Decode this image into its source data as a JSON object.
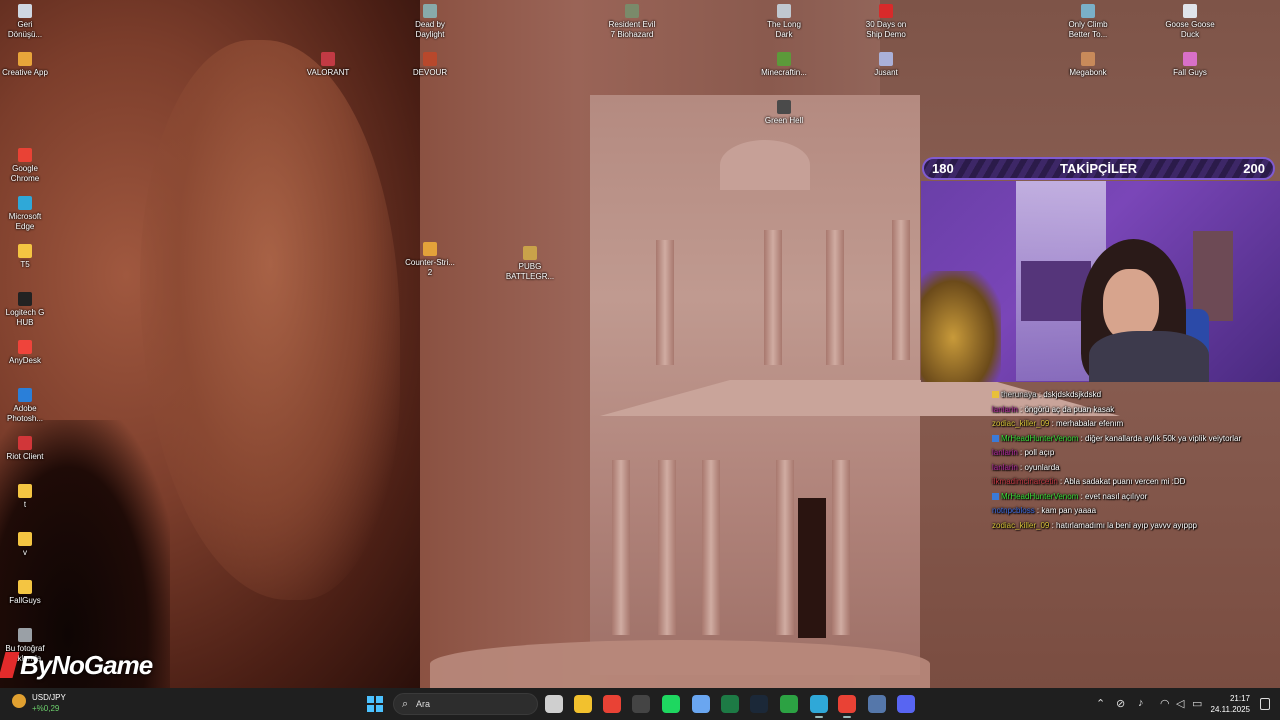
{
  "desktop_icons": [
    {
      "label": "Geri\nDönüşü...",
      "icon": "recycle-bin-icon",
      "color": "#cfd8e3"
    },
    {
      "label": "Creative App",
      "icon": "creative-app-icon",
      "color": "#e8a53a"
    },
    {
      "label": "Google\nChrome",
      "icon": "chrome-icon",
      "color": "#e94235"
    },
    {
      "label": "Microsoft\nEdge",
      "icon": "edge-icon",
      "color": "#2fa8d8"
    },
    {
      "label": "T5",
      "icon": "folder-icon",
      "color": "#f4c542"
    },
    {
      "label": "Logitech G\nHUB",
      "icon": "logitech-icon",
      "color": "#222222"
    },
    {
      "label": "AnyDesk",
      "icon": "anydesk-icon",
      "color": "#ef443b"
    },
    {
      "label": "Adobe\nPhotosh...",
      "icon": "photoshop-icon",
      "color": "#2a7fd9"
    },
    {
      "label": "Riot Client",
      "icon": "riot-icon",
      "color": "#d13639"
    },
    {
      "label": "t",
      "icon": "folder-icon",
      "color": "#f4c542"
    },
    {
      "label": "v",
      "icon": "folder-icon",
      "color": "#f4c542"
    },
    {
      "label": "FallGuys",
      "icon": "folder-icon",
      "color": "#f4c542"
    },
    {
      "label": "Bu fotoğraf\nhakkında",
      "icon": "camera-icon",
      "color": "#9aa0a6"
    },
    {
      "label": "VALORANT",
      "icon": "valorant-icon",
      "color": "#c23a44"
    },
    {
      "label": "Dead by\nDaylight",
      "icon": "dbd-icon",
      "color": "#8aa"
    },
    {
      "label": "DEVOUR",
      "icon": "devour-icon",
      "color": "#b8482c"
    },
    {
      "label": "Counter-Stri...\n2",
      "icon": "cs2-icon",
      "color": "#e3a23a"
    },
    {
      "label": "PUBG\nBATTLEGR...",
      "icon": "pubg-icon",
      "color": "#c9a24a"
    },
    {
      "label": "Resident Evil\n7 Biohazard",
      "icon": "re7-icon",
      "color": "#7a8a6a"
    },
    {
      "label": "The Long\nDark",
      "icon": "long-dark-icon",
      "color": "#c0c8d0"
    },
    {
      "label": "Minecraftin...",
      "icon": "minecraft-icon",
      "color": "#5c9a3a"
    },
    {
      "label": "Green Hell",
      "icon": "green-hell-icon",
      "color": "#4a4a4a"
    },
    {
      "label": "30 Days on\nShip Demo",
      "icon": "ship-icon",
      "color": "#d82a2a"
    },
    {
      "label": "Jusant",
      "icon": "jusant-icon",
      "color": "#aab0d8"
    },
    {
      "label": "Only Climb\nBetter To...",
      "icon": "only-climb-icon",
      "color": "#7ab0c8"
    },
    {
      "label": "Megabonk",
      "icon": "megabonk-icon",
      "color": "#c88a5a"
    },
    {
      "label": "Goose Goose\nDuck",
      "icon": "goose-icon",
      "color": "#e0e4ea"
    },
    {
      "label": "Fall Guys",
      "icon": "fall-guys-icon",
      "color": "#d870c8"
    }
  ],
  "follower_goal": {
    "current": "180",
    "title": "TAKİPÇİLER",
    "target": "200"
  },
  "chat": [
    {
      "user": "therunaya",
      "color": "#d8d8d8",
      "text": ": dskjdskdsjkdskd",
      "badge": "#e8c03a"
    },
    {
      "user": "lanlarin",
      "color": "#b22aa0",
      "text": ": öngörü aç da puan kasak",
      "badge": ""
    },
    {
      "user": "zodiac_killer_09",
      "color": "#d7c23a",
      "text": ": merhabalar efenım",
      "badge": ""
    },
    {
      "user": "MrHeadHunterVenom",
      "color": "#3adf3a",
      "text": ": diğer kanallarda aylık 50k ya viplik veiytorlar",
      "badge": "#3a7ad8"
    },
    {
      "user": "lanlarin",
      "color": "#b22aa0",
      "text": ": poll açıp",
      "badge": ""
    },
    {
      "user": "lanlarin",
      "color": "#b22aa0",
      "text": ": oyunlarda",
      "badge": ""
    },
    {
      "user": "ilkmadimcinarcetin",
      "color": "#c23a44",
      "text": ": Abla sadakat puanı vercen mi :DD",
      "badge": ""
    },
    {
      "user": "MrHeadHunterVenom",
      "color": "#3adf3a",
      "text": ": evet nasıl açılıyor",
      "badge": "#3a7ad8"
    },
    {
      "user": "notnpcbloss",
      "color": "#3a6ae0",
      "text": ": kam pan yaaaa",
      "badge": ""
    },
    {
      "user": "zodiac_killer_09",
      "color": "#d7c23a",
      "text": ": hatırlamadımı la beni ayıp yavvv ayıppp",
      "badge": ""
    }
  ],
  "watermark": "ByNoGame",
  "taskbar": {
    "weather_title": "USD/JPY",
    "weather_value": "+%0,29",
    "search_placeholder": "Ara",
    "apps": [
      {
        "name": "task-view-icon",
        "color": "#cfcfcf"
      },
      {
        "name": "file-explorer-icon",
        "color": "#f2c12e"
      },
      {
        "name": "chrome-icon",
        "color": "#e94235"
      },
      {
        "name": "obs-icon",
        "color": "#444444"
      },
      {
        "name": "spotify-icon",
        "color": "#1ed760"
      },
      {
        "name": "store-icon",
        "color": "#6aa6f0"
      },
      {
        "name": "excel-icon",
        "color": "#1d7a45"
      },
      {
        "name": "steam-icon",
        "color": "#1b2838"
      },
      {
        "name": "xbox-icon",
        "color": "#2ca243"
      },
      {
        "name": "chrome-profile-icon",
        "color": "#2fa8d8"
      },
      {
        "name": "chrome-active-icon",
        "color": "#e94235"
      },
      {
        "name": "vpn-icon",
        "color": "#5577aa"
      },
      {
        "name": "discord-icon",
        "color": "#5865f2"
      }
    ],
    "time": "21:17",
    "date": "24.11.2025"
  }
}
